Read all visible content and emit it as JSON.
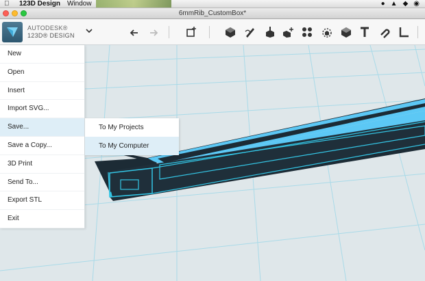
{
  "menubar": {
    "app_name": "123D Design",
    "window_menu": "Window"
  },
  "window": {
    "title": "6mmRib_CustomBox*"
  },
  "brand": {
    "line1": "AUTODESK®",
    "line2": "123D® DESIGN"
  },
  "toolbar": {
    "icons": [
      "undo-icon",
      "redo-icon",
      "add-object-icon",
      "primitives-icon",
      "sketch-icon",
      "construct-icon",
      "modify-icon",
      "pattern-icon",
      "grouping-icon",
      "combine-icon",
      "measure-icon",
      "text-icon",
      "snap-icon",
      "material-icon"
    ]
  },
  "menu": {
    "items": [
      {
        "label": "New"
      },
      {
        "label": "Open"
      },
      {
        "label": "Insert"
      },
      {
        "label": "Import SVG..."
      },
      {
        "label": "Save..."
      },
      {
        "label": "Save a Copy..."
      },
      {
        "label": "3D Print"
      },
      {
        "label": "Send To..."
      },
      {
        "label": "Export STL"
      },
      {
        "label": "Exit"
      }
    ],
    "active_index": 4
  },
  "submenu": {
    "items": [
      {
        "label": "To My Projects"
      },
      {
        "label": "To My Computer"
      }
    ],
    "active_index": 1
  },
  "colors": {
    "accent": "#5cc8f5",
    "model_dark": "#1c2b35",
    "model_edge": "#34c6e6",
    "grid": "#9fd6e6",
    "highlight": "#deeef7"
  }
}
